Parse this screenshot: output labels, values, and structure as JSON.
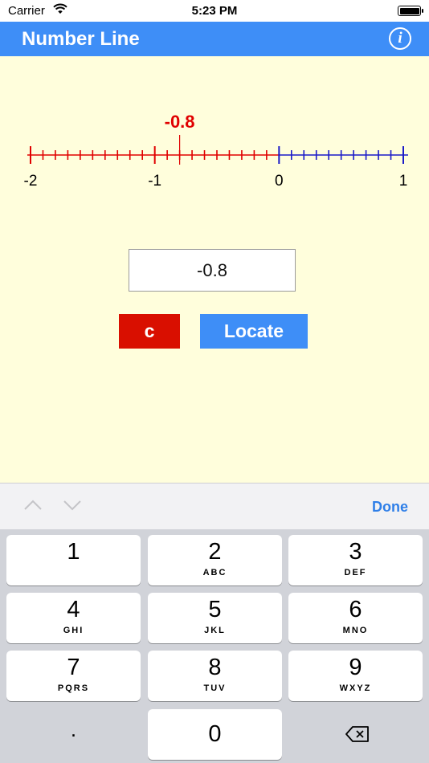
{
  "status_bar": {
    "carrier": "Carrier",
    "time": "5:23 PM"
  },
  "nav": {
    "title": "Number Line",
    "info_label": "i"
  },
  "number_line": {
    "min": -2,
    "max": 1,
    "minor_step": 0.1,
    "major_labels": [
      "-2",
      "-1",
      "0",
      "1"
    ],
    "located_value": -0.8,
    "located_label": "-0.8",
    "negative_color": "#e00000",
    "positive_color": "#1a1ac8"
  },
  "input": {
    "value": "-0.8"
  },
  "buttons": {
    "clear_label": "c",
    "locate_label": "Locate"
  },
  "keyboard": {
    "done_label": "Done",
    "keys": [
      {
        "digit": "1",
        "letters": ""
      },
      {
        "digit": "2",
        "letters": "ABC"
      },
      {
        "digit": "3",
        "letters": "DEF"
      },
      {
        "digit": "4",
        "letters": "GHI"
      },
      {
        "digit": "5",
        "letters": "JKL"
      },
      {
        "digit": "6",
        "letters": "MNO"
      },
      {
        "digit": "7",
        "letters": "PQRS"
      },
      {
        "digit": "8",
        "letters": "TUV"
      },
      {
        "digit": "9",
        "letters": "WXYZ"
      }
    ],
    "decimal": ".",
    "zero": "0",
    "delete_icon": "delete-backspace-icon"
  }
}
